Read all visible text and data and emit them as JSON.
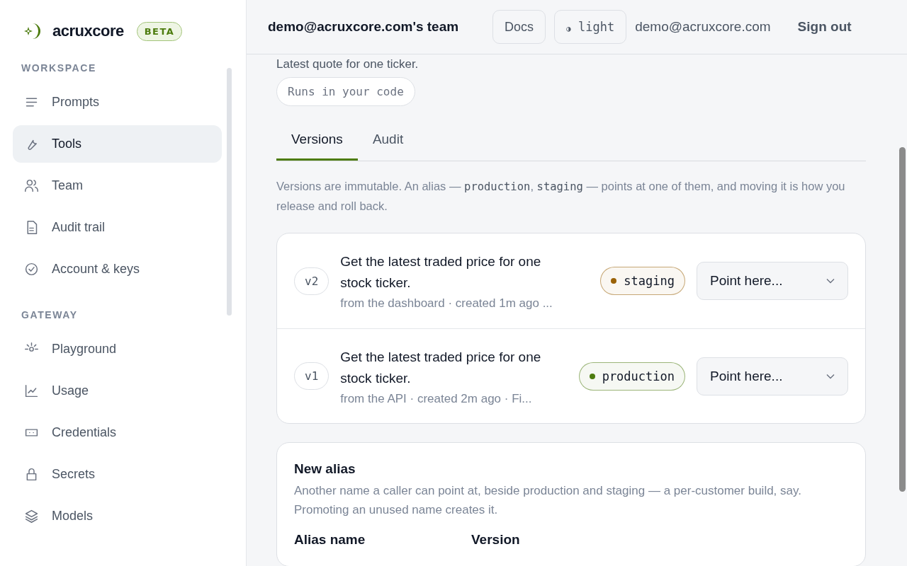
{
  "brand": {
    "name": "acruxcore",
    "badge": "BETA"
  },
  "sidebar": {
    "sections": [
      {
        "title": "WORKSPACE",
        "items": [
          {
            "label": "Prompts",
            "selected": false
          },
          {
            "label": "Tools",
            "selected": true
          },
          {
            "label": "Team",
            "selected": false
          },
          {
            "label": "Audit trail",
            "selected": false
          },
          {
            "label": "Account & keys",
            "selected": false
          }
        ]
      },
      {
        "title": "GATEWAY",
        "items": [
          {
            "label": "Playground",
            "selected": false
          },
          {
            "label": "Usage",
            "selected": false
          },
          {
            "label": "Credentials",
            "selected": false
          },
          {
            "label": "Secrets",
            "selected": false
          },
          {
            "label": "Models",
            "selected": false
          }
        ]
      }
    ]
  },
  "header": {
    "team": "demo@acruxcore.com's team",
    "docs": "Docs",
    "theme_icon": "◑",
    "theme": "light",
    "user": "demo@acruxcore.com",
    "sign_out": "Sign out"
  },
  "tool": {
    "subtitle": "Latest quote for one ticker.",
    "runtime": "Runs in your code"
  },
  "tabs": [
    {
      "label": "Versions",
      "selected": true
    },
    {
      "label": "Audit",
      "selected": false
    }
  ],
  "description": [
    {
      "kind": "text",
      "text": "Versions are immutable. An alias — "
    },
    {
      "kind": "code",
      "text": "production"
    },
    {
      "kind": "text",
      "text": ", "
    },
    {
      "kind": "code",
      "text": "staging"
    },
    {
      "kind": "text",
      "text": " — points at one of them, and moving it is how you release and roll back."
    }
  ],
  "versions": [
    {
      "version": "v2",
      "title": "Get the latest traded price for one stock ticker.",
      "meta": "from the dashboard · created 1m ago ...",
      "alias": {
        "name": "staging",
        "color": "#9a6207"
      },
      "select": "Point here..."
    },
    {
      "version": "v1",
      "title": "Get the latest traded price for one stock ticker.",
      "meta": "from the API · created 2m ago · Fi...",
      "alias": {
        "name": "production",
        "color": "#4d7c0f"
      },
      "select": "Point here..."
    }
  ],
  "new_alias": {
    "title": "New alias",
    "text": "Another name a caller can point at, beside production and staging — a per-customer build, say. Promoting an unused name creates it.",
    "fields": [
      "Alias name",
      "Version"
    ]
  }
}
